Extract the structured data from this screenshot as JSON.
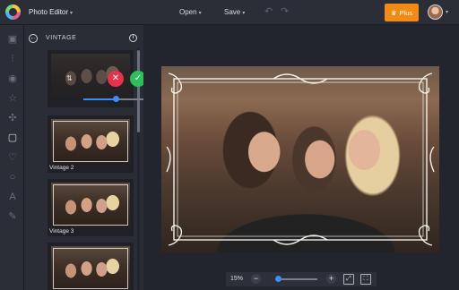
{
  "header": {
    "app_title": "Photo Editor",
    "menu": [
      {
        "label": "Open"
      },
      {
        "label": "Save"
      }
    ],
    "plus_label": "Plus",
    "accent_color": "#f28a16"
  },
  "rail": {
    "icons": [
      "image-icon",
      "adjust-icon",
      "eye-icon",
      "star-icon",
      "shape-icon",
      "frame-icon",
      "heart-icon",
      "circle-icon",
      "text-icon",
      "edit-icon"
    ],
    "active": "frame-icon"
  },
  "panel": {
    "title": "VINTAGE",
    "intensity": 0.5,
    "items": [
      {
        "label": "Vintage 2"
      },
      {
        "label": "Vintage 3"
      }
    ]
  },
  "canvas": {
    "zoom": "15%",
    "zoom_level": 0.05
  }
}
